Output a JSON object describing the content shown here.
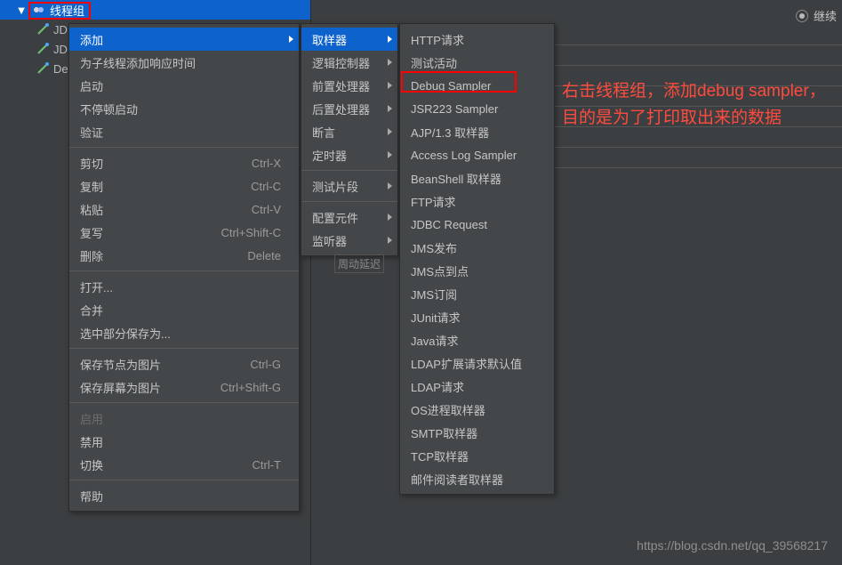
{
  "tree": {
    "root_label": "线程组",
    "items": [
      "JD",
      "JD",
      "De"
    ]
  },
  "menu1": {
    "add": "添加",
    "add_timer": "为子线程添加响应时间",
    "start": "启动",
    "start_no_pause": "不停顿启动",
    "validate": "验证",
    "cut": "剪切",
    "cut_sc": "Ctrl-X",
    "copy": "复制",
    "copy_sc": "Ctrl-C",
    "paste": "粘贴",
    "paste_sc": "Ctrl-V",
    "duplicate": "复写",
    "duplicate_sc": "Ctrl+Shift-C",
    "delete": "删除",
    "delete_sc": "Delete",
    "open": "打开...",
    "merge": "合并",
    "save_sel": "选中部分保存为...",
    "save_node_img": "保存节点为图片",
    "save_node_sc": "Ctrl-G",
    "save_screen_img": "保存屏幕为图片",
    "save_screen_sc": "Ctrl+Shift-G",
    "enable": "启用",
    "disable": "禁用",
    "toggle": "切换",
    "toggle_sc": "Ctrl-T",
    "help": "帮助"
  },
  "menu2": {
    "sampler": "取样器",
    "logic": "逻辑控制器",
    "pre": "前置处理器",
    "post": "后置处理器",
    "assert": "断言",
    "timer": "定时器",
    "fragment": "测试片段",
    "config": "配置元件",
    "listener": "监听器"
  },
  "menu3": {
    "items": [
      "HTTP请求",
      "测试活动",
      "Debug Sampler",
      "JSR223 Sampler",
      "AJP/1.3 取样器",
      "Access Log Sampler",
      "BeanShell 取样器",
      "FTP请求",
      "JDBC Request",
      "JMS发布",
      "JMS点到点",
      "JMS订阅",
      "JUnit请求",
      "Java请求",
      "LDAP扩展请求默认值",
      "LDAP请求",
      "OS进程取样器",
      "SMTP取样器",
      "TCP取样器",
      "邮件阅读者取样器"
    ]
  },
  "annotation": "右击线程组，添加debug sampler，目的是为了打印取出来的数据",
  "radio_label": "继续",
  "watermark": "https://blog.csdn.net/qq_39568217",
  "fragment_text": "周动延迟"
}
